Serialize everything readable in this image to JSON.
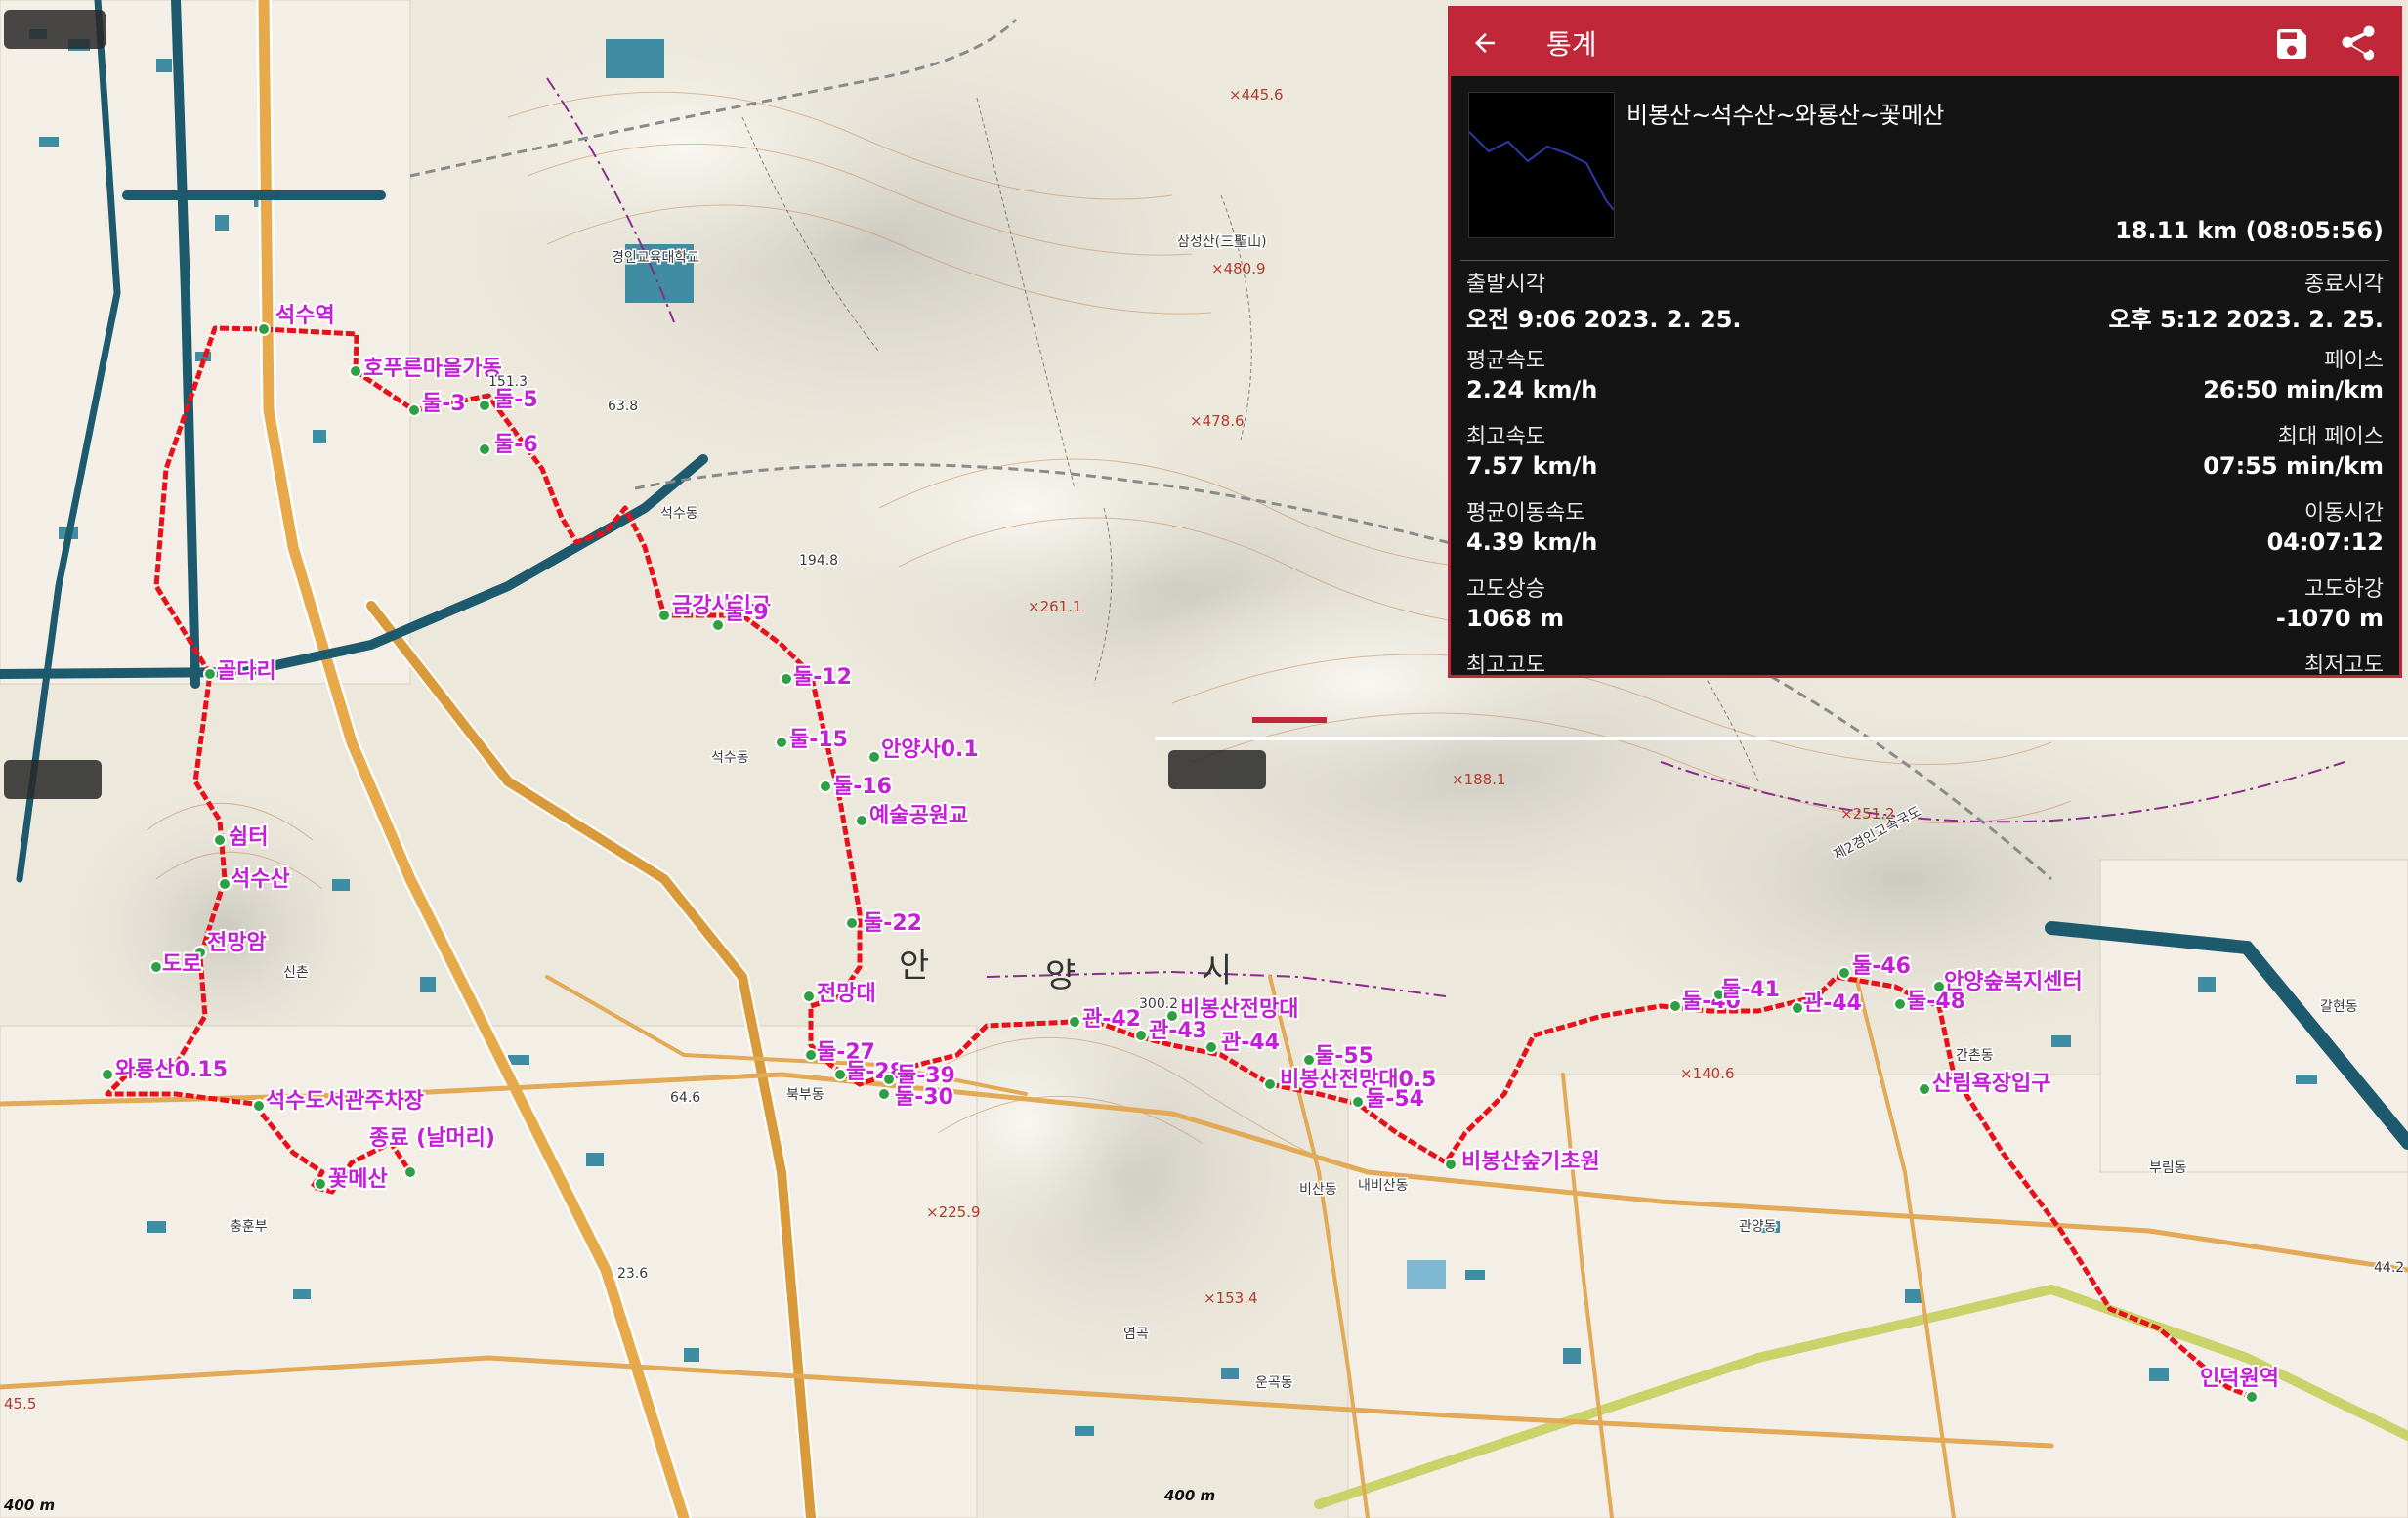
{
  "stats_panel": {
    "title": "통계",
    "track_name": "비봉산~석수산~와룡산~꽃메산",
    "distance_time": "18.11 km (08:05:56)",
    "rows": [
      {
        "left_label": "출발시각",
        "left_value": "오전 9:06 2023. 2. 25.",
        "right_label": "종료시각",
        "right_value": "오후 5:12 2023. 2. 25."
      },
      {
        "left_label": "평균속도",
        "left_value": "2.24 km/h",
        "right_label": "페이스",
        "right_value": "26:50 min/km"
      },
      {
        "left_label": "최고속도",
        "left_value": "7.57 km/h",
        "right_label": "최대 페이스",
        "right_value": "07:55 min/km"
      },
      {
        "left_label": "평균이동속도",
        "left_value": "4.39 km/h",
        "right_label": "이동시간",
        "right_value": "04:07:12"
      },
      {
        "left_label": "고도상승",
        "left_value": "1068 m",
        "right_label": "고도하강",
        "right_value": "-1070 m"
      },
      {
        "left_label": "최고고도",
        "left_value": "",
        "right_label": "최저고도",
        "right_value": ""
      }
    ],
    "icons": {
      "back": "arrow-back-icon",
      "save": "save-icon",
      "share": "share-icon"
    }
  },
  "waypoints": [
    {
      "label": "석수역"
    },
    {
      "label": "호푸른마을가동"
    },
    {
      "label": "둘-3"
    },
    {
      "label": "둘-5"
    },
    {
      "label": "둘-6"
    },
    {
      "label": "금강사입구"
    },
    {
      "label": "둘-9"
    },
    {
      "label": "둘-12"
    },
    {
      "label": "둘-15"
    },
    {
      "label": "안양사0.1"
    },
    {
      "label": "둘-16"
    },
    {
      "label": "예술공원교"
    },
    {
      "label": "둘-22"
    },
    {
      "label": "전망대"
    },
    {
      "label": "둘-27"
    },
    {
      "label": "둘-28"
    },
    {
      "label": "둘-39"
    },
    {
      "label": "둘-30"
    },
    {
      "label": "관-42"
    },
    {
      "label": "관-43"
    },
    {
      "label": "비봉산전망대"
    },
    {
      "label": "관-44"
    },
    {
      "label": "둘-55"
    },
    {
      "label": "비봉산전망대0.5"
    },
    {
      "label": "둘-54"
    },
    {
      "label": "비봉산숲기초원"
    },
    {
      "label": "둘-40"
    },
    {
      "label": "둘-41"
    },
    {
      "label": "관-44"
    },
    {
      "label": "둘-46"
    },
    {
      "label": "둘-48"
    },
    {
      "label": "안양숲복지센터"
    },
    {
      "label": "산림욕장입구"
    },
    {
      "label": "인덕원역"
    },
    {
      "label": "골다리"
    },
    {
      "label": "쉼터"
    },
    {
      "label": "석수산"
    },
    {
      "label": "전망암"
    },
    {
      "label": "도로"
    },
    {
      "label": "와룡산0.15"
    },
    {
      "label": "석수도서관주차장"
    },
    {
      "label": "종료 (날머리)"
    },
    {
      "label": "꽃메산"
    }
  ],
  "places": {
    "seoksu_dong": "석수동",
    "bisan_dong": "비산동",
    "gwanyang_dong": "관양동",
    "galhyeon_dong": "갈현동",
    "anyang": "안",
    "yang": "양",
    "si": "시",
    "sinchon": "신촌",
    "samseongsan": "삼성산(三聖山)",
    "gyeongin_univ": "경인교육대학교",
    "yeomgok": "염곡",
    "uncheon": "운곡동",
    "naebisan": "내비산동",
    "gansan": "간촌동",
    "buribdong": "부림동",
    "chunghun": "충훈부",
    "bukbu": "북부동",
    "expressway": "제2경인고속국도"
  },
  "elevations": {
    "e1": "×445.6",
    "e2": "×480.9",
    "e3": "×478.6",
    "e4": "×261.1",
    "e5": "×188.1",
    "e6": "×251.2",
    "e7": "×140.6",
    "e8": "×225.9",
    "e9": "×153.4",
    "e10": "194.8",
    "e11": "151.3",
    "e12": "63.8",
    "e13": "300.2",
    "e14": "64.6",
    "e15": "45.5",
    "e16": "44.2",
    "e17": "23.6"
  },
  "scale": {
    "left": "400 m",
    "right": "400 m"
  },
  "colors": {
    "track": "#e8101a",
    "waypoint_label": "#c21fd6",
    "panel_bg": "#141414",
    "panel_accent": "#c0283a",
    "road_major": "#d89a3a",
    "road_teal": "#1e5a6e"
  }
}
